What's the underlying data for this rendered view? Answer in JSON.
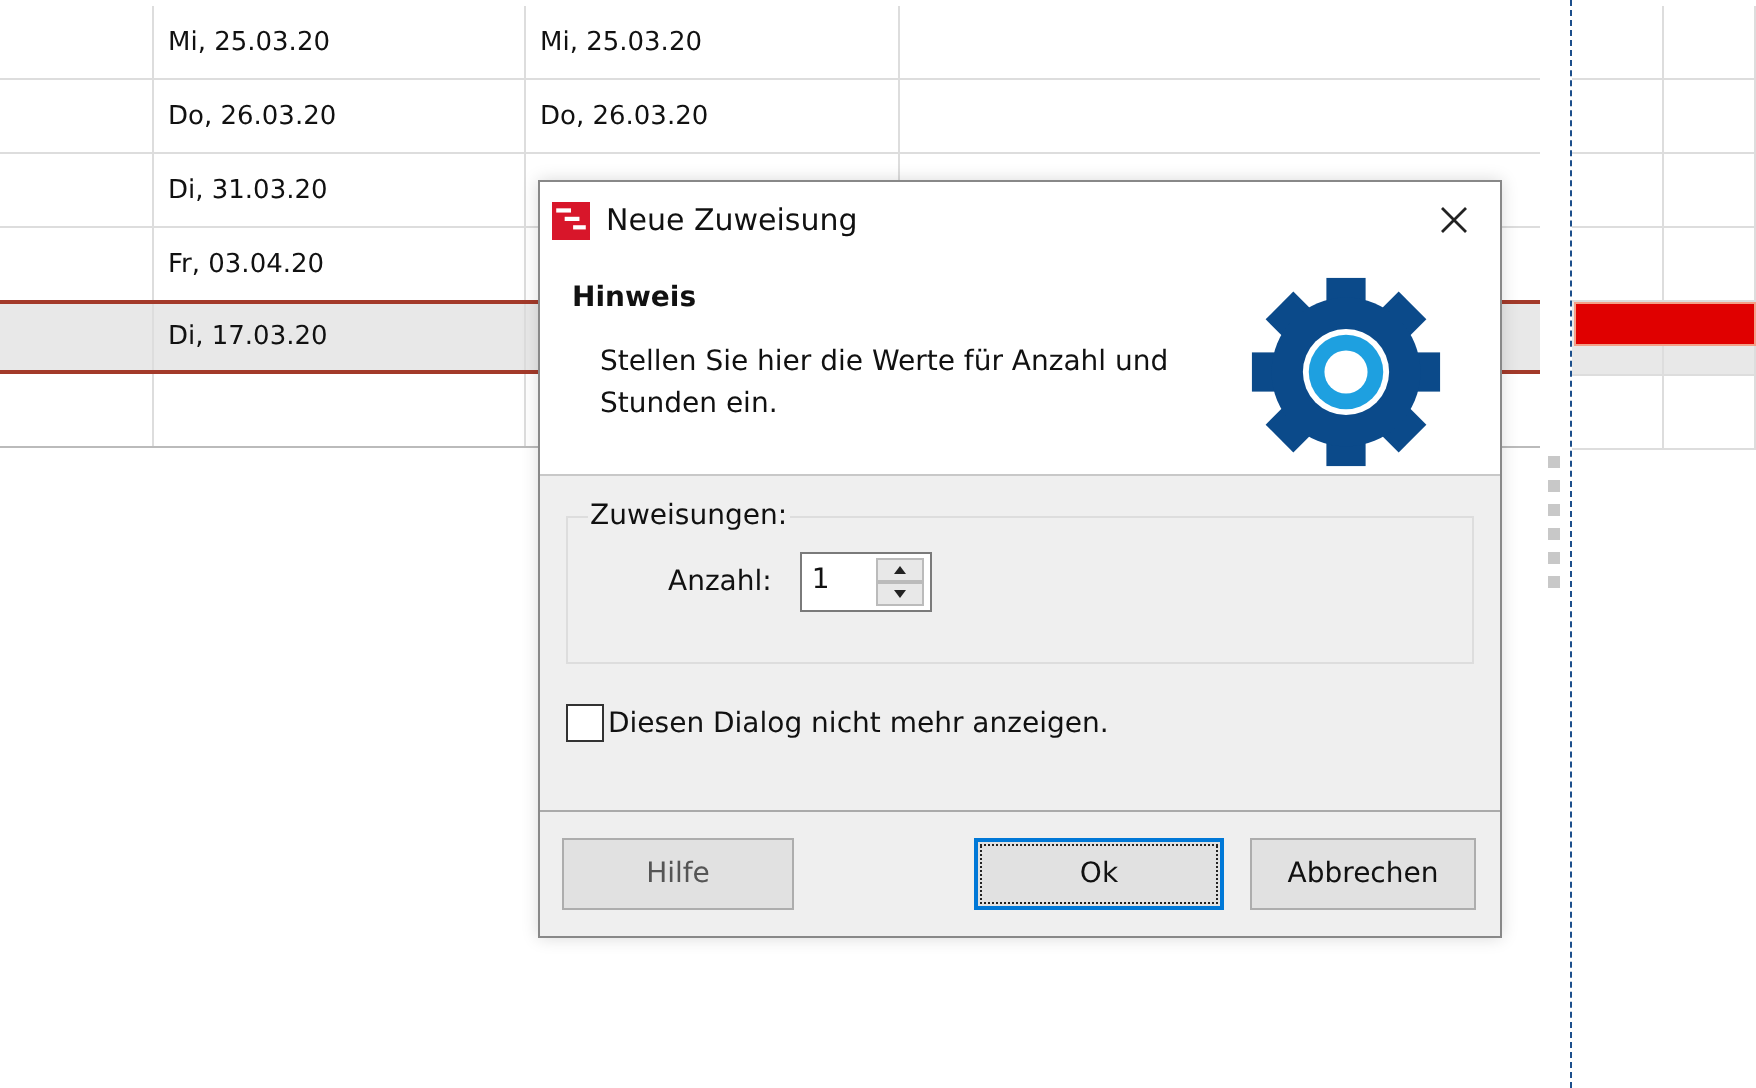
{
  "table": {
    "rows": [
      {
        "cells": [
          "",
          "Mi, 25.03.20",
          "Mi, 25.03.20",
          ""
        ],
        "selected": false,
        "bar": false
      },
      {
        "cells": [
          "",
          "Do, 26.03.20",
          "Do, 26.03.20",
          ""
        ],
        "selected": false,
        "bar": false
      },
      {
        "cells": [
          "",
          "Di, 31.03.20",
          "",
          ""
        ],
        "selected": false,
        "bar": false
      },
      {
        "cells": [
          "",
          "Fr, 03.04.20",
          "",
          ""
        ],
        "selected": false,
        "bar": false
      },
      {
        "cells": [
          "",
          "Di, 17.03.20",
          "",
          ""
        ],
        "selected": true,
        "bar": true
      },
      {
        "cells": [
          "",
          "",
          "",
          ""
        ],
        "selected": false,
        "bar": false
      }
    ]
  },
  "dialog": {
    "title": "Neue Zuweisung",
    "heading": "Hinweis",
    "message": "Stellen Sie hier die Werte für Anzahl und Stunden ein.",
    "group_label": "Zuweisungen:",
    "field_label": "Anzahl:",
    "field_value": "1",
    "checkbox": {
      "label": "Diesen Dialog nicht mehr anzeigen.",
      "checked": false
    },
    "buttons": [
      {
        "label": "Hilfe",
        "default": false
      },
      {
        "label": "Ok",
        "default": true
      },
      {
        "label": "Abbrechen",
        "default": false
      }
    ]
  }
}
